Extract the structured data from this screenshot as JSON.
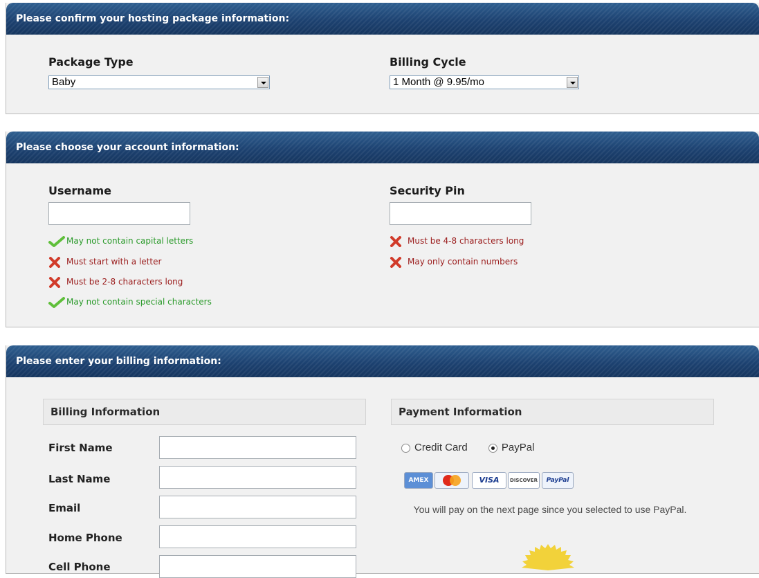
{
  "hosting": {
    "header": "Please confirm your hosting package information:",
    "package_type": {
      "label": "Package Type",
      "value": "Baby"
    },
    "billing_cycle": {
      "label": "Billing Cycle",
      "value": "1 Month @ 9.95/mo"
    }
  },
  "account": {
    "header": "Please choose your account information:",
    "username": {
      "label": "Username",
      "value": "",
      "rules": [
        {
          "text": "May not contain capital letters",
          "status": "ok"
        },
        {
          "text": "Must start with a letter",
          "status": "bad"
        },
        {
          "text": "Must be 2-8 characters long",
          "status": "bad"
        },
        {
          "text": "May not contain special characters",
          "status": "ok"
        }
      ]
    },
    "security_pin": {
      "label": "Security Pin",
      "value": "",
      "rules": [
        {
          "text": "Must be 4-8 characters long",
          "status": "bad"
        },
        {
          "text": "May only contain numbers",
          "status": "bad"
        }
      ]
    }
  },
  "billing": {
    "header": "Please enter your billing information:",
    "billing_info": {
      "title": "Billing Information",
      "fields": [
        {
          "label": "First Name",
          "value": ""
        },
        {
          "label": "Last Name",
          "value": ""
        },
        {
          "label": "Email",
          "value": ""
        },
        {
          "label": "Home Phone",
          "value": ""
        },
        {
          "label": "Cell Phone",
          "value": ""
        }
      ]
    },
    "payment_info": {
      "title": "Payment Information",
      "options": [
        {
          "label": "Credit Card",
          "checked": false
        },
        {
          "label": "PayPal",
          "checked": true
        }
      ],
      "cards": [
        "AMEX",
        "MasterCard",
        "VISA",
        "DISCOVER",
        "PayPal"
      ],
      "note": "You will pay on the next page since you selected to use PayPal."
    }
  },
  "colors": {
    "header_bg": "#1d4271",
    "panel_bg": "#f1f1f1",
    "ok_text": "#2a9a2a",
    "bad_text": "#9a1b1b",
    "seal": "#f2d23a"
  }
}
